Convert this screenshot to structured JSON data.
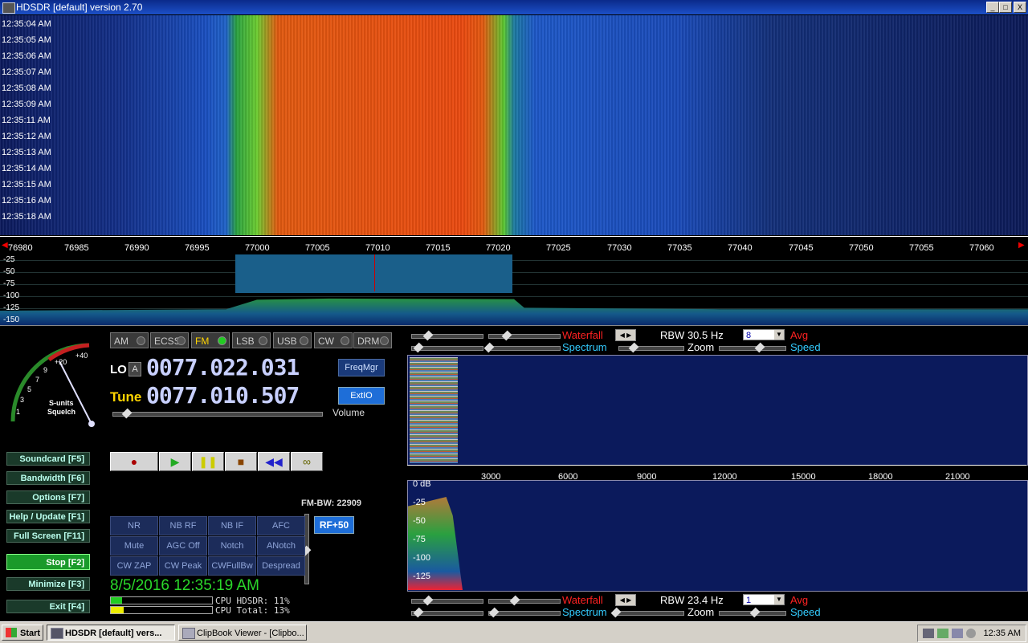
{
  "window": {
    "title": "HDSDR [default]  version 2.70",
    "controls": [
      "_",
      "□",
      "X"
    ]
  },
  "waterfall": {
    "timestamps": [
      "12:35:04 AM",
      "12:35:05 AM",
      "12:35:06 AM",
      "12:35:07 AM",
      "12:35:08 AM",
      "12:35:09 AM",
      "12:35:11 AM",
      "12:35:12 AM",
      "12:35:13 AM",
      "12:35:14 AM",
      "12:35:15 AM",
      "12:35:16 AM",
      "12:35:18 AM"
    ]
  },
  "freq_axis": {
    "labels": [
      "76980",
      "76985",
      "76990",
      "76995",
      "77000",
      "77005",
      "77010",
      "77015",
      "77020",
      "77025",
      "77030",
      "77035",
      "77040",
      "77045",
      "77050",
      "77055",
      "77060"
    ]
  },
  "spectrum": {
    "db_labels": [
      "-25",
      "-50",
      "-75",
      "-100",
      "-125",
      "-150"
    ]
  },
  "smeter": {
    "scale_labels": [
      "1",
      "3",
      "5",
      "7",
      "9",
      "+20",
      "+40"
    ],
    "caption1": "S-units",
    "caption2": "Squelch"
  },
  "modes": [
    "AM",
    "ECSS",
    "FM",
    "LSB",
    "USB",
    "CW",
    "DRM"
  ],
  "selected_mode": "FM",
  "lo": {
    "label": "LO",
    "tag": "A",
    "value": "0077.022.031"
  },
  "tune": {
    "label": "Tune",
    "value": "0077.010.507"
  },
  "freqmgr_label": "FreqMgr",
  "extio_label": "ExtIO",
  "volume_label": "Volume",
  "fkeys": [
    {
      "label": "Soundcard  [F5]"
    },
    {
      "label": "Bandwidth  [F6]"
    },
    {
      "label": "Options  [F7]"
    },
    {
      "label": "Help / Update  [F1]"
    },
    {
      "label": "Full Screen  [F11]"
    },
    {
      "label": "Stop        [F2]"
    },
    {
      "label": "Minimize  [F3]"
    },
    {
      "label": "Exit      [F4]"
    }
  ],
  "transport_icons": [
    "record-icon",
    "play-icon",
    "pause-icon",
    "stop-icon",
    "rewind-icon",
    "loop-icon"
  ],
  "fm_bw": "FM-BW: 22909",
  "rf_button": "RF+50",
  "dsp_buttons": [
    "NR",
    "NB RF",
    "NB IF",
    "AFC",
    "Mute",
    "AGC Off",
    "Notch",
    "ANotch",
    "CW ZAP",
    "CW Peak",
    "CWFullBw",
    "Despread"
  ],
  "datetime": "8/5/2016 12:35:19 AM",
  "cpu": {
    "hdsdr": "CPU HDSDR: 11%",
    "total": "CPU Total: 13%",
    "hdsdr_fraction": 0.11,
    "total_fraction": 0.13
  },
  "rf_controls": {
    "waterfall_label": "Waterfall",
    "spectrum_label": "Spectrum",
    "rbw": "RBW 30.5 Hz",
    "zoom_label": "Zoom",
    "avg_value": "8",
    "avg_label": "Avg",
    "speed_label": "Speed"
  },
  "af_axis": {
    "labels": [
      "3000",
      "6000",
      "9000",
      "12000",
      "15000",
      "18000",
      "21000"
    ]
  },
  "af_db_labels": [
    "0 dB",
    "-25",
    "-50",
    "-75",
    "-100",
    "-125"
  ],
  "af_controls": {
    "waterfall_label": "Waterfall",
    "spectrum_label": "Spectrum",
    "rbw": "RBW 23.4 Hz",
    "zoom_label": "Zoom",
    "avg_value": "1",
    "avg_label": "Avg",
    "speed_label": "Speed"
  },
  "taskbar": {
    "start": "Start",
    "tasks": [
      "HDSDR [default]  vers...",
      "ClipBook Viewer - [Clipbo..."
    ],
    "clock": "12:35 AM"
  }
}
